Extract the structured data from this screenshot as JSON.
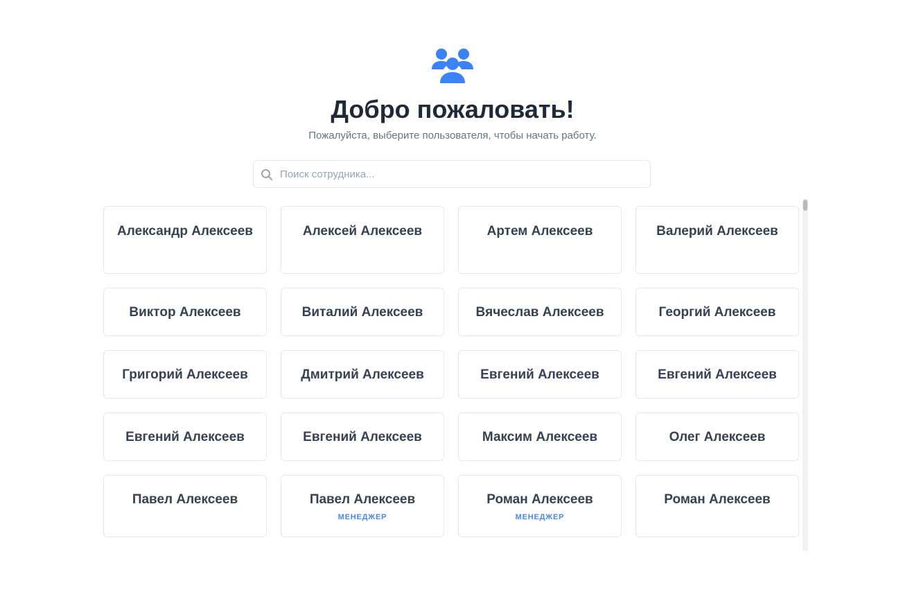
{
  "header": {
    "logo_icon": "users-icon",
    "title": "Добро пожаловать!",
    "subtitle": "Пожалуйста, выберите пользователя, чтобы начать работу."
  },
  "search": {
    "placeholder": "Поиск сотрудника...",
    "value": ""
  },
  "colors": {
    "accent": "#3b82f6",
    "title": "#1f2937",
    "muted": "#6b7280",
    "border": "#e5e7eb",
    "role": "#4a86e8"
  },
  "users": [
    {
      "name": "Александр Алексеев",
      "role": ""
    },
    {
      "name": "Алексей Алексеев",
      "role": ""
    },
    {
      "name": "Артем Алексеев",
      "role": ""
    },
    {
      "name": "Валерий Алексеев",
      "role": ""
    },
    {
      "name": "Виктор Алексеев",
      "role": ""
    },
    {
      "name": "Виталий Алексеев",
      "role": ""
    },
    {
      "name": "Вячеслав Алексеев",
      "role": ""
    },
    {
      "name": "Георгий Алексеев",
      "role": ""
    },
    {
      "name": "Григорий Алексеев",
      "role": ""
    },
    {
      "name": "Дмитрий Алексеев",
      "role": ""
    },
    {
      "name": "Евгений Алексеев",
      "role": ""
    },
    {
      "name": "Евгений Алексеев",
      "role": ""
    },
    {
      "name": "Евгений Алексеев",
      "role": ""
    },
    {
      "name": "Евгений Алексеев",
      "role": ""
    },
    {
      "name": "Максим Алексеев",
      "role": ""
    },
    {
      "name": "Олег Алексеев",
      "role": ""
    },
    {
      "name": "Павел Алексеев",
      "role": ""
    },
    {
      "name": "Павел Алексеев",
      "role": "МЕНЕДЖЕР"
    },
    {
      "name": "Роман Алексеев",
      "role": "МЕНЕДЖЕР"
    },
    {
      "name": "Роман Алексеев",
      "role": ""
    }
  ]
}
